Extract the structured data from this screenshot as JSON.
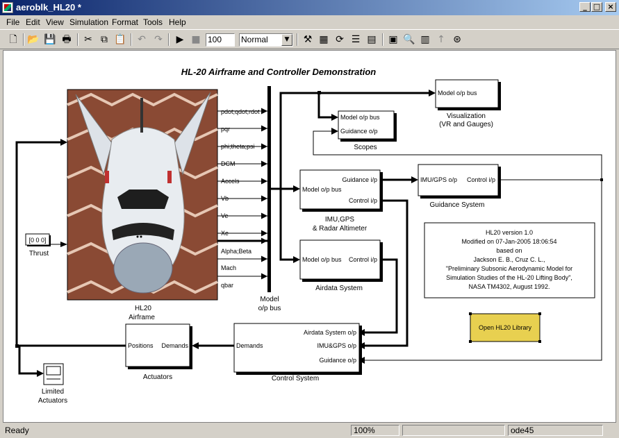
{
  "window": {
    "title": "aeroblk_HL20 *",
    "buttons": {
      "minimize": "_",
      "maximize": "□",
      "close": "×"
    }
  },
  "menu": [
    "File",
    "Edit",
    "View",
    "Simulation",
    "Format",
    "Tools",
    "Help"
  ],
  "toolbar": {
    "stop_time": "100",
    "mode": "Normal"
  },
  "diagram": {
    "title": "HL-20 Airframe and Controller Demonstration",
    "airframe": {
      "label1": "HL20",
      "label2": "Airframe",
      "outputs": [
        "pdot;qdot;rdot",
        "pqr",
        "phi;theta;psi",
        "DCM",
        "Accels",
        "Vb",
        "Ve",
        "Xe",
        "Alpha;Beta",
        "Mach",
        "qbar"
      ]
    },
    "bus": {
      "label1": "Model",
      "label2": "o/p bus"
    },
    "visualization": {
      "port": "Model o/p  bus",
      "label1": "Visualization",
      "label2": "(VR and Gauges)"
    },
    "scopes": {
      "port1": "Model o/p bus",
      "port2": "Guidance o/p",
      "label": "Scopes"
    },
    "imu": {
      "in_port": "Model o/p bus",
      "out1": "Guidance i/p",
      "out2": "Control i/p",
      "label1": "IMU,GPS",
      "label2": "& Radar Altimeter"
    },
    "guidance": {
      "in_port": "IMU/GPS o/p",
      "out_port": "Control i/p",
      "label": "Guidance System"
    },
    "airdata": {
      "in_port": "Model o/p bus",
      "out_port": "Control i/p",
      "label": "Airdata System"
    },
    "control": {
      "in1": "Airdata System o/p",
      "in2": "IMU&GPS o/p",
      "in3": "Guidance o/p",
      "out": "Demands",
      "label": "Control System"
    },
    "actuators": {
      "in_port": "Demands",
      "out_port": "Positions",
      "label": "Actuators"
    },
    "thrust": {
      "value": "[0 0 0]",
      "label": "Thrust"
    },
    "limited": {
      "label1": "Limited",
      "label2": "Actuators"
    },
    "info": {
      "lines": [
        "HL20 version 1.0",
        "Modified on 07-Jan-2005 18:06:54",
        "based on",
        "Jackson E. B., Cruz C. L.,",
        "\"Preliminary Subsonic Aerodynamic Model for",
        "Simulation Studies of the HL-20 Lifting Body\",",
        "NASA TM4302, August 1992."
      ]
    },
    "library_button": "Open HL20 Library"
  },
  "status": {
    "left": "Ready",
    "zoom": "100%",
    "solver": "ode45"
  },
  "colors": {
    "title_dark": "#0a246a",
    "title_light": "#a6caf0",
    "library_button": "#e8d050",
    "canvas": "#ffffff"
  }
}
